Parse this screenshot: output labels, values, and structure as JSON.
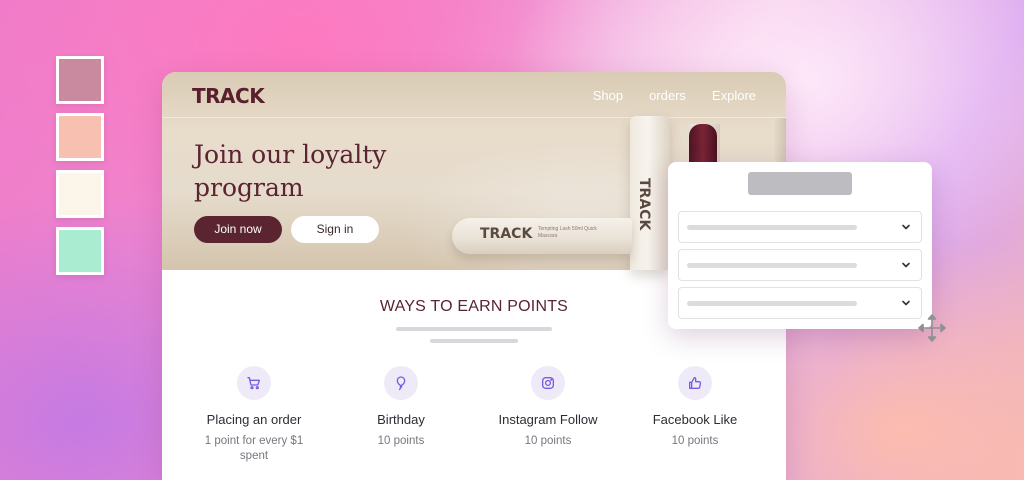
{
  "colors": {
    "swatches": [
      "#c98a9f",
      "#f8c0b1",
      "#fcf6ea",
      "#a9ecd1"
    ],
    "brand": "#5a2430",
    "icon_accent": "#7b5be0"
  },
  "nav": {
    "logo": "TRACK",
    "links": [
      "Shop",
      "orders",
      "Explore"
    ]
  },
  "hero": {
    "title": "Join our loyalty program",
    "join_button": "Join now",
    "signin_button": "Sign in",
    "product_brand": "TRACK",
    "product_sub": "Tempting Lash 50ml Quick Mascara"
  },
  "ways": {
    "title": "WAYS TO EARN POINTS",
    "items": [
      {
        "name": "Placing an order",
        "points": "1 point for every $1 spent",
        "icon": "cart-icon"
      },
      {
        "name": "Birthday",
        "points": "10 points",
        "icon": "balloon-icon"
      },
      {
        "name": "Instagram Follow",
        "points": "10 points",
        "icon": "instagram-icon"
      },
      {
        "name": "Facebook Like",
        "points": "10 points",
        "icon": "thumbs-up-icon"
      }
    ]
  },
  "panel": {
    "dropdown_icon": "chevron-down-icon",
    "move_icon": "move-icon"
  }
}
